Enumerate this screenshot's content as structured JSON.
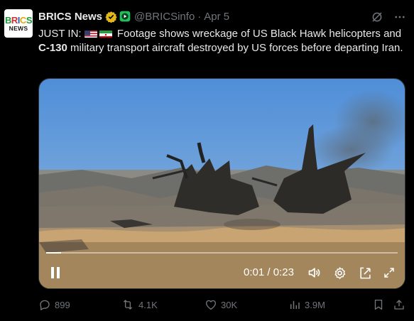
{
  "account": {
    "name": "BRICS News",
    "handle": "@BRICSinfo",
    "date": "Apr 5",
    "avatar_top": "BRICS",
    "avatar_bottom": "NEWS"
  },
  "colors": {
    "verified_gold": "#e2b719",
    "affiliate_green": "#20c05c",
    "muted": "#71767b",
    "text": "#e7e9ea",
    "background": "#000000"
  },
  "post": {
    "prefix": "JUST IN:",
    "flags": [
      "us-flag-icon",
      "iran-flag-icon"
    ],
    "text_part1": "Footage shows wreckage of US Black Hawk helicopters and",
    "bold_term": "C-130",
    "text_part2": "military transport aircraft destroyed by US forces before departing Iran."
  },
  "video": {
    "time_current": "0:01",
    "time_separator": "/",
    "time_total": "0:23",
    "progress_fraction": 0.043
  },
  "actions": {
    "replies": "899",
    "reposts": "4.1K",
    "likes": "30K",
    "views": "3.9M"
  }
}
